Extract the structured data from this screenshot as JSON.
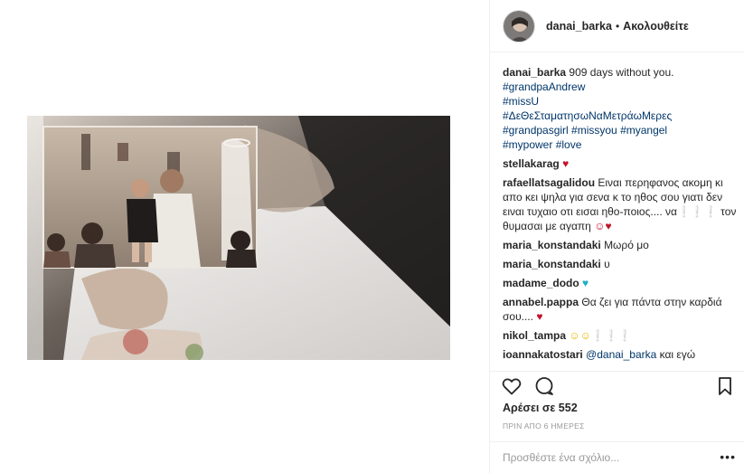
{
  "header": {
    "username": "danai_barka",
    "separator": "•",
    "follow_label": "Ακολουθείτε"
  },
  "caption": {
    "username": "danai_barka",
    "text": "909 days without you.",
    "hashtags": [
      "#grandpaAndrew",
      "#missU",
      "#ΔεΘεΣταματησωΝαΜετράωΜερες",
      "#grandpasgirl #missyou #myangel",
      "#mypower #love"
    ]
  },
  "comments": [
    {
      "username": "stellakarag",
      "text": "",
      "suffix": "♥"
    },
    {
      "username": "rafaellatsagalidou",
      "text": "Ειναι περηφανος ακομη κι απο κει ψηλα για σενα κ το ηθος σου γιατι δεν ειναι τυχαιο οτι εισαι ηθο-ποιος.... να❕❕❕ τον θυμασαι με αγαπη",
      "suffix": "☺♥"
    },
    {
      "username": "maria_konstandaki",
      "text": "Μωρό μο",
      "suffix": ""
    },
    {
      "username": "maria_konstandaki",
      "text": "υ",
      "suffix": ""
    },
    {
      "username": "madame_dodo",
      "text": "",
      "suffix": "♥"
    },
    {
      "username": "annabel.pappa",
      "text": "Θα ζει για πάντα στην καρδιά σου....",
      "suffix": "♥"
    },
    {
      "username": "nikol_tampa",
      "text": "",
      "suffix": "☺☺❕❕❕"
    },
    {
      "username": "ioannakatostari",
      "mention": "@danai_barka",
      "text": "και εγώ",
      "suffix": ""
    }
  ],
  "actions": {
    "like_icon": "heart-outline-icon",
    "comment_icon": "comment-bubble-icon",
    "save_icon": "bookmark-icon"
  },
  "likes": {
    "label": "Αρέσει σε 552"
  },
  "timestamp": "ΠΡΙΝ ΑΠΟ 6 ΗΜΕΡΕΣ",
  "add_comment": {
    "placeholder": "Προσθέστε ένα σχόλιο...",
    "more_label": "•••"
  },
  "colors": {
    "link": "#003569",
    "heart": "#c0142b",
    "cyan_heart": "#1ab0c6",
    "border": "#efefef"
  }
}
